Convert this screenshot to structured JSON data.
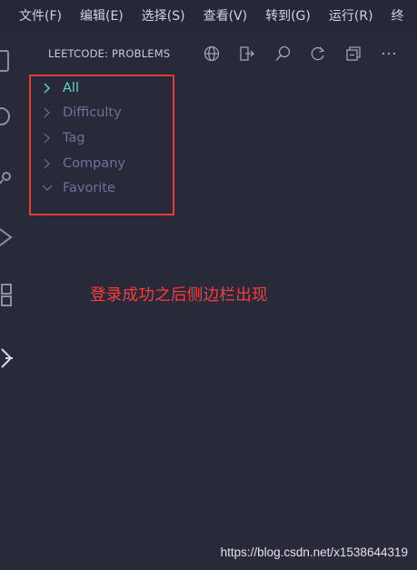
{
  "menubar": {
    "items": [
      {
        "label": "文件(F)"
      },
      {
        "label": "编辑(E)"
      },
      {
        "label": "选择(S)"
      },
      {
        "label": "查看(V)"
      },
      {
        "label": "转到(G)"
      },
      {
        "label": "运行(R)"
      },
      {
        "label": "终"
      }
    ]
  },
  "activitybar": {
    "icons": [
      "explorer-icon",
      "search-icon",
      "source-control-icon",
      "run-icon",
      "extensions-icon",
      "leetcode-icon"
    ]
  },
  "sidebar": {
    "title": "LEETCODE: PROBLEMS",
    "actions": [
      {
        "icon": "globe-icon"
      },
      {
        "icon": "sign-out-icon"
      },
      {
        "icon": "search-icon"
      },
      {
        "icon": "refresh-icon"
      },
      {
        "icon": "collapse-all-icon"
      },
      {
        "icon": "more-icon"
      }
    ],
    "tree": [
      {
        "label": "All",
        "state": "collapsed",
        "active": true
      },
      {
        "label": "Difficulty",
        "state": "collapsed",
        "active": false
      },
      {
        "label": "Tag",
        "state": "collapsed",
        "active": false
      },
      {
        "label": "Company",
        "state": "collapsed",
        "active": false
      },
      {
        "label": "Favorite",
        "state": "expanded",
        "active": false
      }
    ]
  },
  "annotation": {
    "text": "登录成功之后侧边栏出现"
  },
  "watermark": {
    "text": "https://blog.csdn.net/x1538644319"
  },
  "colors": {
    "background": "#282a3a",
    "menubar": "#262837",
    "active_item": "#66d4c2",
    "tree_item": "#6c7399",
    "highlight_border": "#e13b36",
    "annotation": "#ff3b3b"
  }
}
